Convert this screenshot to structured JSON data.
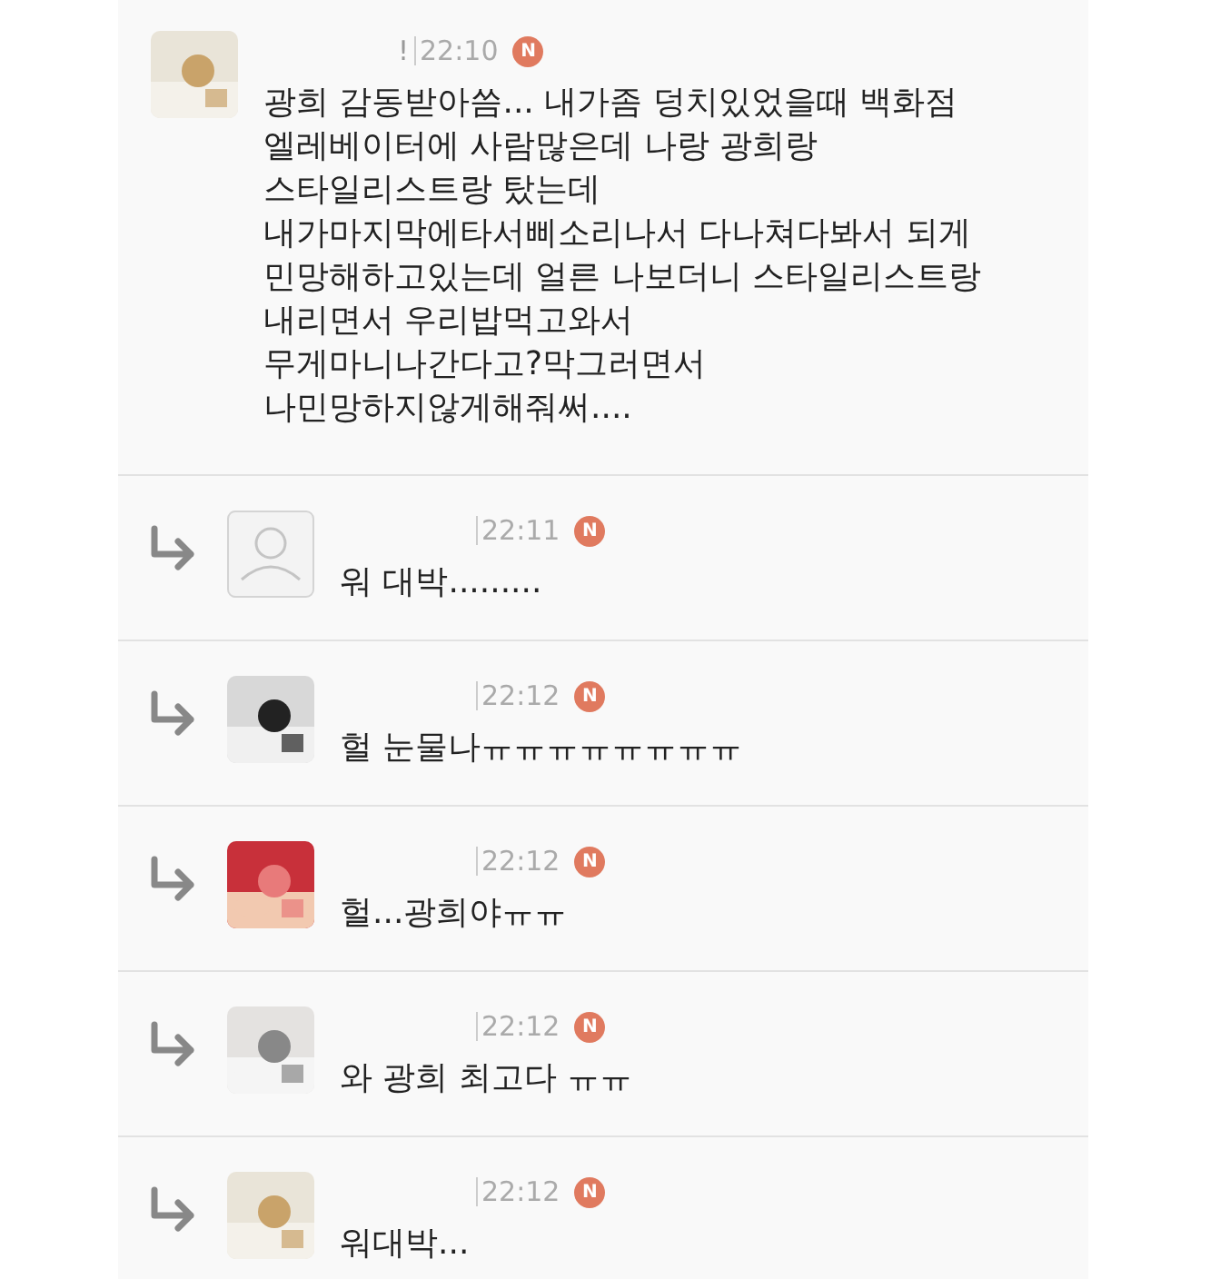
{
  "comments": [
    {
      "reply": false,
      "name_tail": "!",
      "time": "22:10",
      "badge": "N",
      "text": [
        "광희 감동받아씀... 내가좀 덩치있었을때 백화점",
        "엘레베이터에 사람많은데 나랑 광희랑",
        "스타일리스트랑 탔는데",
        "내가마지막에타서삐소리나서 다나쳐다봐서 되게",
        "민망해하고있는데 얼른 나보더니 스타일리스트랑",
        "내리면서 우리밥먹고와서",
        "무게마니나간다고?막그러면서",
        "나민망하지않게해줘써...."
      ]
    },
    {
      "reply": true,
      "avatar": {
        "kind": "default"
      },
      "time": "22:11",
      "badge": "N",
      "text": [
        "워 대박........."
      ]
    },
    {
      "reply": true,
      "time": "22:12",
      "badge": "N",
      "text": [
        "헐 눈물나ㅠㅠㅠㅠㅠㅠㅠㅠ"
      ]
    },
    {
      "reply": true,
      "time": "22:12",
      "badge": "N",
      "text": [
        "헐...광희야ㅠㅠ"
      ]
    },
    {
      "reply": true,
      "time": "22:12",
      "badge": "N",
      "text": [
        "와 광희 최고다 ㅠㅠ"
      ]
    },
    {
      "reply": true,
      "time": "22:12",
      "badge": "N",
      "text": [
        "워대박..."
      ]
    }
  ]
}
